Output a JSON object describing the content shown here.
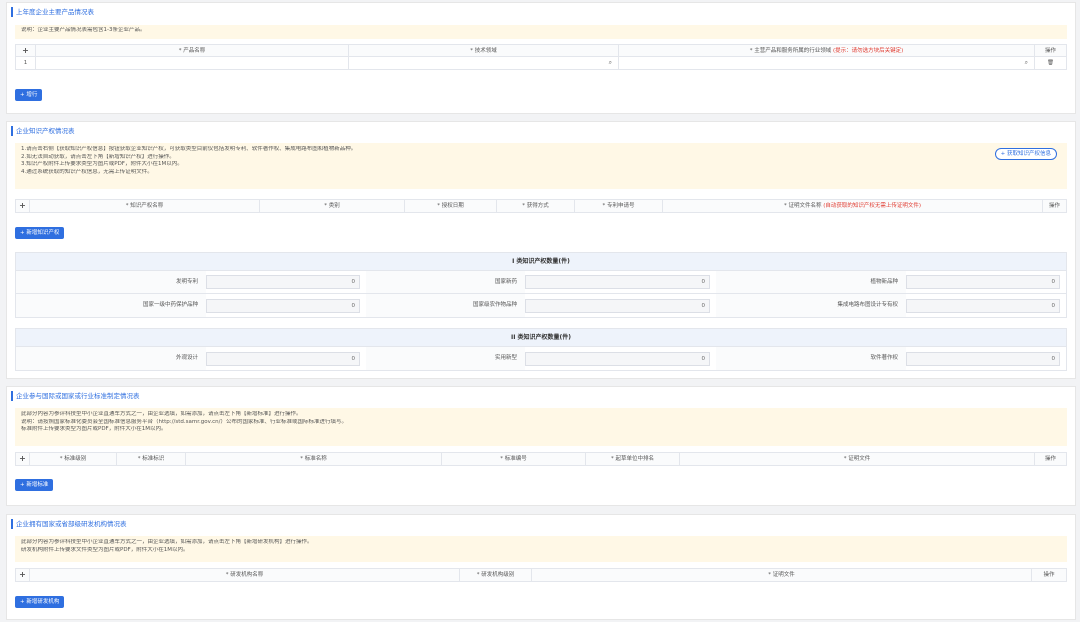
{
  "s1": {
    "title": "上年度企业主要产品情况表",
    "note": "说明：企业主要产品情况表需包含1-3条企业产品。",
    "cols": [
      "+",
      "* 产品名称",
      "* 技术领域",
      "* 主营产品和服务所属的行业领域",
      "操作"
    ],
    "col3_hint": "(提示：请勿选方块后关键定)",
    "row_index": "1",
    "add_btn": "+ 增行"
  },
  "s2": {
    "title": "企业知识产权情况表",
    "notes": [
      "1.请点击右侧【获取知识产权信息】按钮获取企业知识产权，可获取类型目前仅包括发明专利、软件著作权、集成电路布图和植物新品种。",
      "2.如无法自动获取，请点击左下角【新增知识产权】进行操作。",
      "3.知识产权附件上传要求类型为图片或PDF，附件大小在1M以内。",
      "4.通过系统获取的知识产权信息，无需上传证明文件。"
    ],
    "fetch_btn": "+ 获取知识产权信息",
    "cols": [
      "+",
      "* 知识产权名称",
      "* 类别",
      "* 授权日期",
      "* 获得方式",
      "* 专利申请号",
      "* 证明文件名称",
      "操作"
    ],
    "col7_hint": "(自动获取的知识产权无需上传证明文件)",
    "add_btn": "+ 新增知识产权",
    "group1_title": "I 类知识产权数量(件)",
    "group1": [
      [
        {
          "label": "发明专利",
          "value": "0"
        },
        {
          "label": "国家新药",
          "value": "0"
        },
        {
          "label": "植物新品种",
          "value": "0"
        }
      ],
      [
        {
          "label": "国家一级中药保护品种",
          "value": "0"
        },
        {
          "label": "国家级农作物品种",
          "value": "0"
        },
        {
          "label": "集成电路布图设计专有权",
          "value": "0"
        }
      ]
    ],
    "group2_title": "II 类知识产权数量(件)",
    "group2": [
      [
        {
          "label": "外观设计",
          "value": "0"
        },
        {
          "label": "实用新型",
          "value": "0"
        },
        {
          "label": "软件著作权",
          "value": "0"
        }
      ]
    ]
  },
  "s3": {
    "title": "企业参与国际或国家或行业标准制定情况表",
    "notes": [
      "此部分内容为参评科技型中小企业直通车方式之一，由企业选填，如需添加，请点击左下角【新增标准】进行操作。",
      "说明：请按照国家标准化委员会全国标准信息服务平台（http://std.samr.gov.cn/）公布的国家标准、行业标准或国际标准进行填写。",
      "标准附件上传要求类型为图片或PDF，附件大小在1M以内。"
    ],
    "cols": [
      "+",
      "* 标准级别",
      "* 标准标识",
      "* 标准名称",
      "* 标准编号",
      "* 起草单位中排名",
      "* 证明文件",
      "操作"
    ],
    "add_btn": "+ 新增标准"
  },
  "s4": {
    "title": "企业拥有国家或省部级研发机构情况表",
    "notes": [
      "此部分内容为参评科技型中小企业直通车方式之一，由企业选填，如需添加，请点击左下角【新增研发机构】进行操作。",
      "研发机构附件上传要求文件类型为图片或PDF，附件大小在1M以内。"
    ],
    "cols": [
      "+",
      "* 研发机构名称",
      "* 研发机构级别",
      "* 证明文件",
      "操作"
    ],
    "add_btn": "+ 新增研发机构"
  },
  "icons": {
    "search": "magnifier-icon",
    "delete": "trash-icon"
  },
  "colors": {
    "accent": "#2f6fe0",
    "note_bg": "#fff8e6",
    "danger": "#e03a2f"
  }
}
